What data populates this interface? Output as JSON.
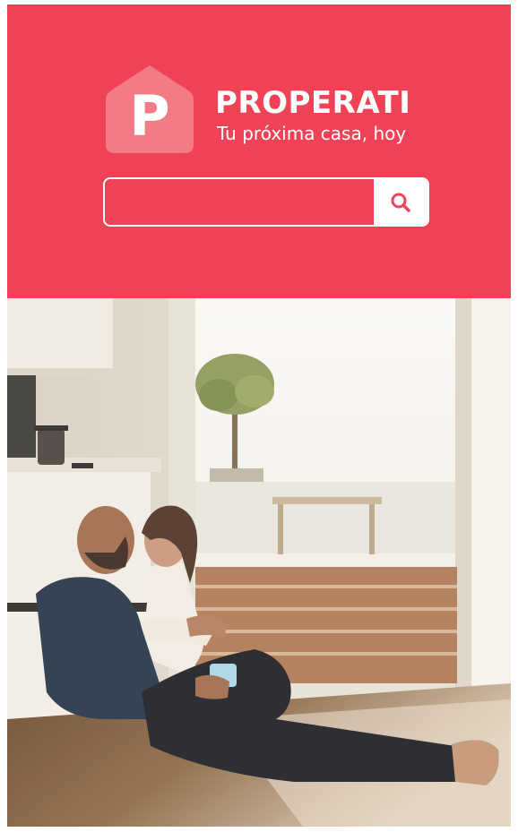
{
  "brand": {
    "name": "PROPERATI",
    "logo_letter": "P",
    "tagline": "Tu próxima casa, hoy"
  },
  "search": {
    "value": "",
    "placeholder": "",
    "icon": "search-icon"
  },
  "colors": {
    "accent": "#ef4256",
    "logo_mark": "#f37b86",
    "white": "#ffffff"
  }
}
